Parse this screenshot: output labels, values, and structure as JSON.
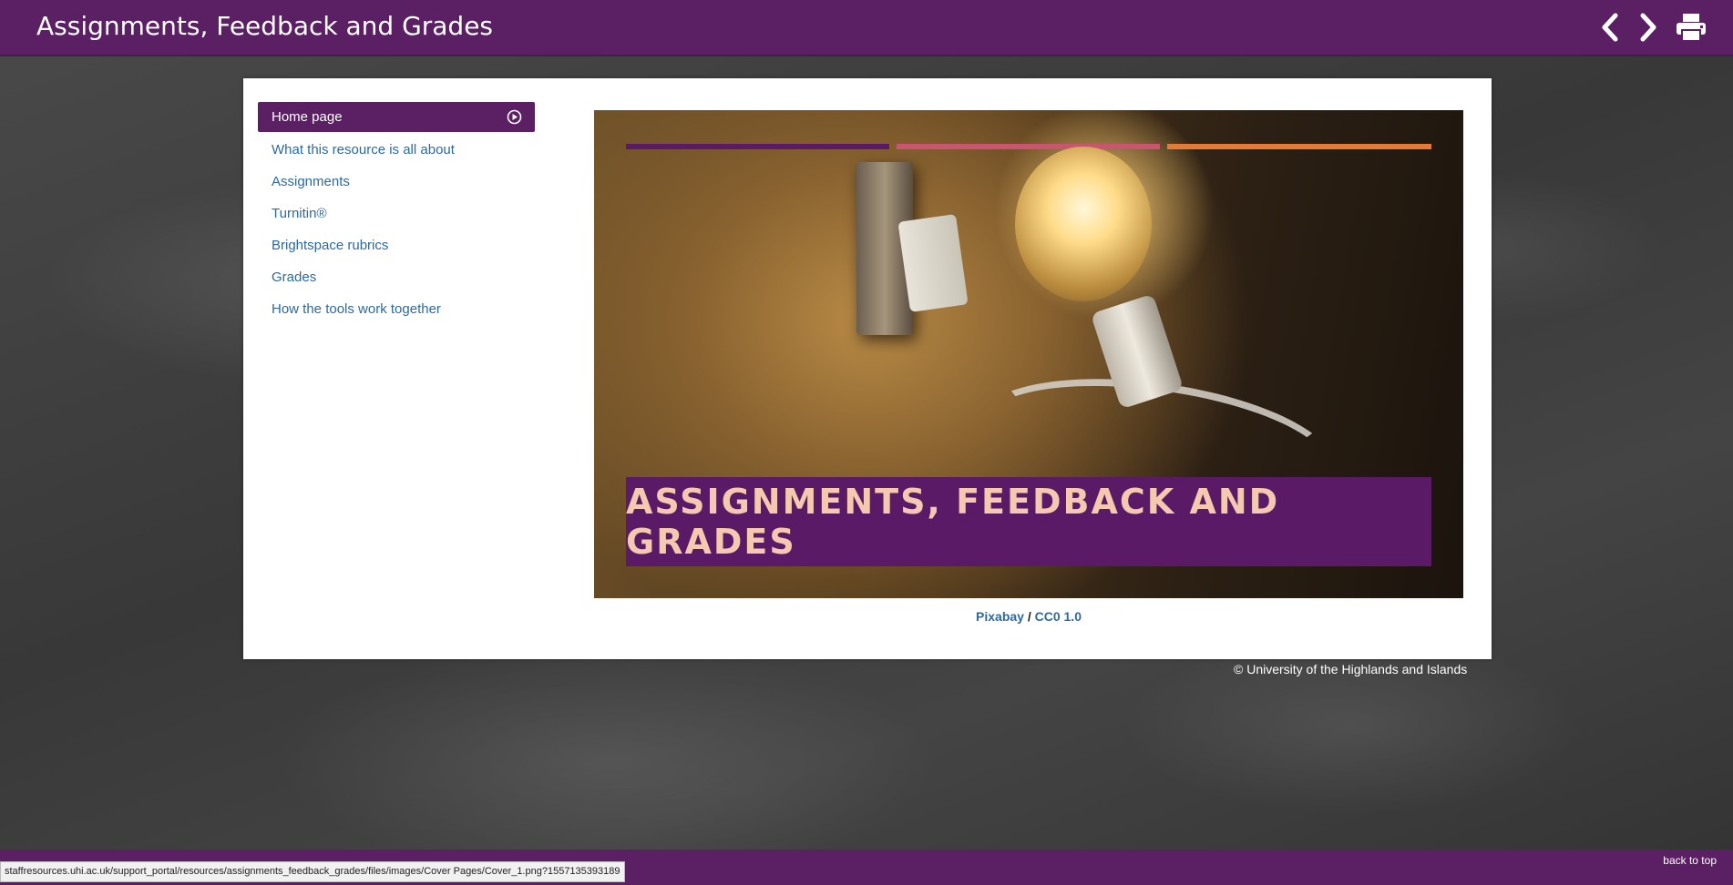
{
  "header": {
    "title": "Assignments, Feedback and Grades",
    "icons": [
      "chevron-left-icon",
      "chevron-right-icon",
      "printer-icon"
    ]
  },
  "sidebar": {
    "items": [
      {
        "label": "Home page",
        "active": true
      },
      {
        "label": "What this resource is all about"
      },
      {
        "label": "Assignments"
      },
      {
        "label": "Turnitin®"
      },
      {
        "label": "Brightspace rubrics"
      },
      {
        "label": "Grades"
      },
      {
        "label": "How the tools work together"
      }
    ]
  },
  "cover": {
    "banner_text": "ASSIGNMENTS, FEEDBACK AND GRADES",
    "stripe_colors": [
      "#5b1a66",
      "#c9566f",
      "#e37a38"
    ]
  },
  "credit": {
    "source": "Pixabay",
    "separator": " / ",
    "license": "CC0 1.0"
  },
  "copyright": "© University of the Highlands and Islands",
  "footer": {
    "back_to_top": "back to top"
  },
  "status_url": "staffresources.uhi.ac.uk/support_portal/resources/assignments_feedback_grades/files/images/Cover Pages/Cover_1.png?1557135393189",
  "colors": {
    "brand_purple": "#5b1f63",
    "link_blue": "#2c6aa0"
  }
}
